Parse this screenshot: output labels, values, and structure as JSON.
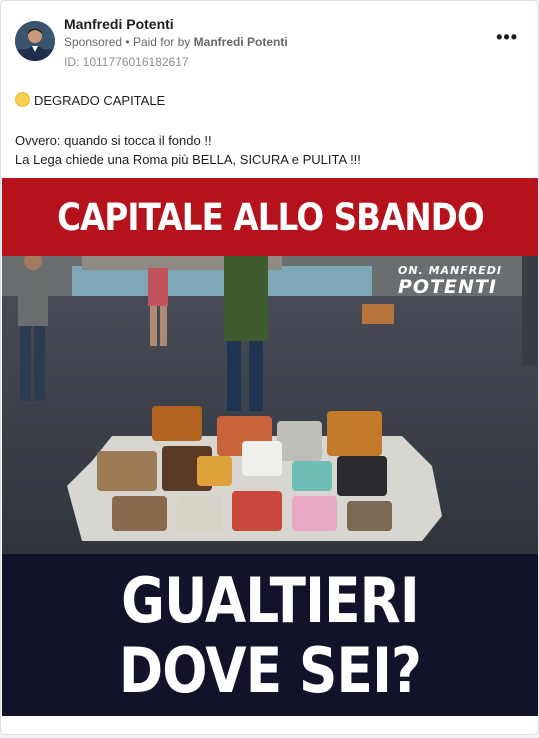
{
  "post": {
    "author": "Manfredi Potenti",
    "sponsored": "Sponsored",
    "paid_for_prefix": "Paid for by",
    "paid_for_name": "Manfredi Potenti",
    "ad_id": "ID: 1011776016182617",
    "menu_icon": "more-icon",
    "text": {
      "line1": "DEGRADO CAPITALE",
      "line2": "Ovvero: quando si tocca il fondo !!",
      "line3": "La Lega chiede una Roma più BELLA, SICURA e PULITA !!!"
    },
    "emoji_color": "#f8cf4e"
  },
  "image": {
    "banner_text": "CAPITALE ALLO SBANDO",
    "banner_color": "#b5121b",
    "signature_small": "ON. MANFREDI",
    "signature_big": "POTENTI",
    "headline_line1": "GUALTIERI",
    "headline_line2": "DOVE SEI?",
    "headline_bg": "#12132a"
  }
}
